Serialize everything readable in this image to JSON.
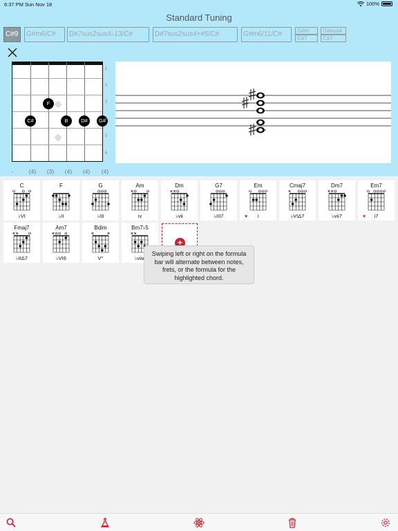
{
  "status_bar": {
    "time": "6:37 PM",
    "date": "Sun Nov 18",
    "battery": "100%"
  },
  "title": "Standard Tuning",
  "formula_bar": {
    "items": [
      "C#9",
      "G#m6/C#",
      "D#7sus2sus4♭13/C#",
      "D#7sus2sus4+#5/C#",
      "G#m6/11/C#"
    ],
    "stacked": [
      {
        "top": "G#m",
        "bottom": "C#7"
      },
      {
        "top": "G#sus4",
        "bottom": "C#7"
      }
    ]
  },
  "fretboard": {
    "fret_numbers": [
      "1",
      "2",
      "3",
      "4",
      "5",
      "6"
    ],
    "notes": [
      "F",
      "C#",
      "B",
      "D#",
      "G#"
    ],
    "string_frets": [
      "-",
      "(4)",
      "(3)",
      "(4)",
      "(4)",
      "(4)"
    ]
  },
  "chord_palette": [
    {
      "name": "C",
      "numeral": "♭VI",
      "heart": false
    },
    {
      "name": "F",
      "numeral": "♭II",
      "heart": false
    },
    {
      "name": "G",
      "numeral": "♭III",
      "heart": false
    },
    {
      "name": "Am",
      "numeral": "iv",
      "heart": false
    },
    {
      "name": "Dm",
      "numeral": "♭vii",
      "heart": false
    },
    {
      "name": "G7",
      "numeral": "♭III7",
      "heart": false
    },
    {
      "name": "Em",
      "numeral": "i",
      "heart": true
    },
    {
      "name": "Cmaj7",
      "numeral": "♭VIΔ7",
      "heart": false
    },
    {
      "name": "Dm7",
      "numeral": "♭vii7",
      "heart": false
    },
    {
      "name": "Em7",
      "numeral": "i7",
      "heart": true
    },
    {
      "name": "Fmaj7",
      "numeral": "♭IIΔ7",
      "heart": false
    },
    {
      "name": "Am7",
      "numeral": "♭VI6",
      "heart": false
    },
    {
      "name": "Bdim",
      "numeral": "V°",
      "heart": false
    },
    {
      "name": "Bm7♭5",
      "numeral": "♭viiø",
      "heart": false
    }
  ],
  "add_chord": {
    "label": "+"
  },
  "tooltip": "Swiping left or right on the formula bar will alternate between notes, frets, or the formula for the highlighted chord.",
  "toolbar": {
    "icons": [
      "search-icon",
      "flask-icon",
      "atom-icon",
      "trash-icon",
      "gear-icon"
    ]
  },
  "colors": {
    "accent": "#d61d2a",
    "panel": "#b3e8fb"
  }
}
